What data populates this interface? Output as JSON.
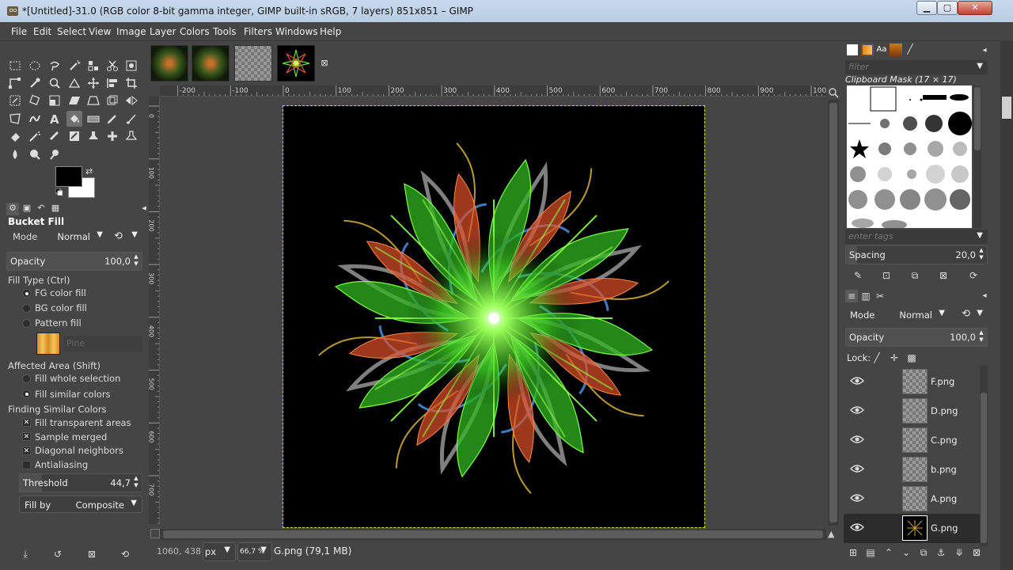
{
  "window": {
    "title": "*[Untitled]-31.0 (RGB color 8-bit gamma integer, GIMP built-in sRGB, 7 layers) 851x851 – GIMP",
    "minimize": "▁",
    "maximize": "▢",
    "close": "✕"
  },
  "menu": [
    "File",
    "Edit",
    "Select",
    "View",
    "Image",
    "Layer",
    "Colors",
    "Tools",
    "Filters",
    "Windows",
    "Help"
  ],
  "tool_options": {
    "title": "Bucket Fill",
    "mode_label": "Mode",
    "mode_value": "Normal",
    "opacity_label": "Opacity",
    "opacity_value": "100,0",
    "fill_type_label": "Fill Type  (Ctrl)",
    "fill_types": [
      "FG color fill",
      "BG color fill",
      "Pattern fill"
    ],
    "fill_type_selected": 0,
    "pattern_name": "Pine",
    "affected_area_label": "Affected Area  (Shift)",
    "affected_areas": [
      "Fill whole selection",
      "Fill similar colors"
    ],
    "affected_area_selected": 1,
    "finding_label": "Finding Similar Colors",
    "options": [
      {
        "label": "Fill transparent areas",
        "checked": true
      },
      {
        "label": "Sample merged",
        "checked": true
      },
      {
        "label": "Diagonal neighbors",
        "checked": true
      },
      {
        "label": "Antialiasing",
        "checked": false
      }
    ],
    "threshold_label": "Threshold",
    "threshold_value": "44,7",
    "threshold_fraction": 0.18,
    "fillby_label": "Fill by",
    "fillby_value": "Composite"
  },
  "rulers": {
    "horizontal": [
      "-200",
      "-100",
      "0",
      "100",
      "200",
      "300",
      "400",
      "500",
      "600",
      "700",
      "800",
      "900",
      "1000"
    ],
    "vertical": [
      "0",
      "100",
      "200",
      "300",
      "400",
      "500",
      "600",
      "700",
      "800"
    ]
  },
  "status": {
    "coords": "1060, 438",
    "unit": "px",
    "zoom": "66,7 %",
    "message": "G.png (79,1 MB)"
  },
  "brushes": {
    "filter_placeholder": "filter",
    "brush_name": "Clipboard Mask (17 × 17)",
    "tags_placeholder": "enter tags",
    "spacing_label": "Spacing",
    "spacing_value": "20,0"
  },
  "layers": {
    "mode_label": "Mode",
    "mode_value": "Normal",
    "opacity_label": "Opacity",
    "opacity_value": "100,0",
    "lock_label": "Lock:",
    "items": [
      {
        "name": "F.png",
        "active": false
      },
      {
        "name": "D.png",
        "active": false
      },
      {
        "name": "C.png",
        "active": false
      },
      {
        "name": "b.png",
        "active": false
      },
      {
        "name": "A.png",
        "active": false
      },
      {
        "name": "G.png",
        "active": true
      }
    ]
  },
  "colors": {
    "fg": "#000000",
    "bg": "#ffffff"
  }
}
